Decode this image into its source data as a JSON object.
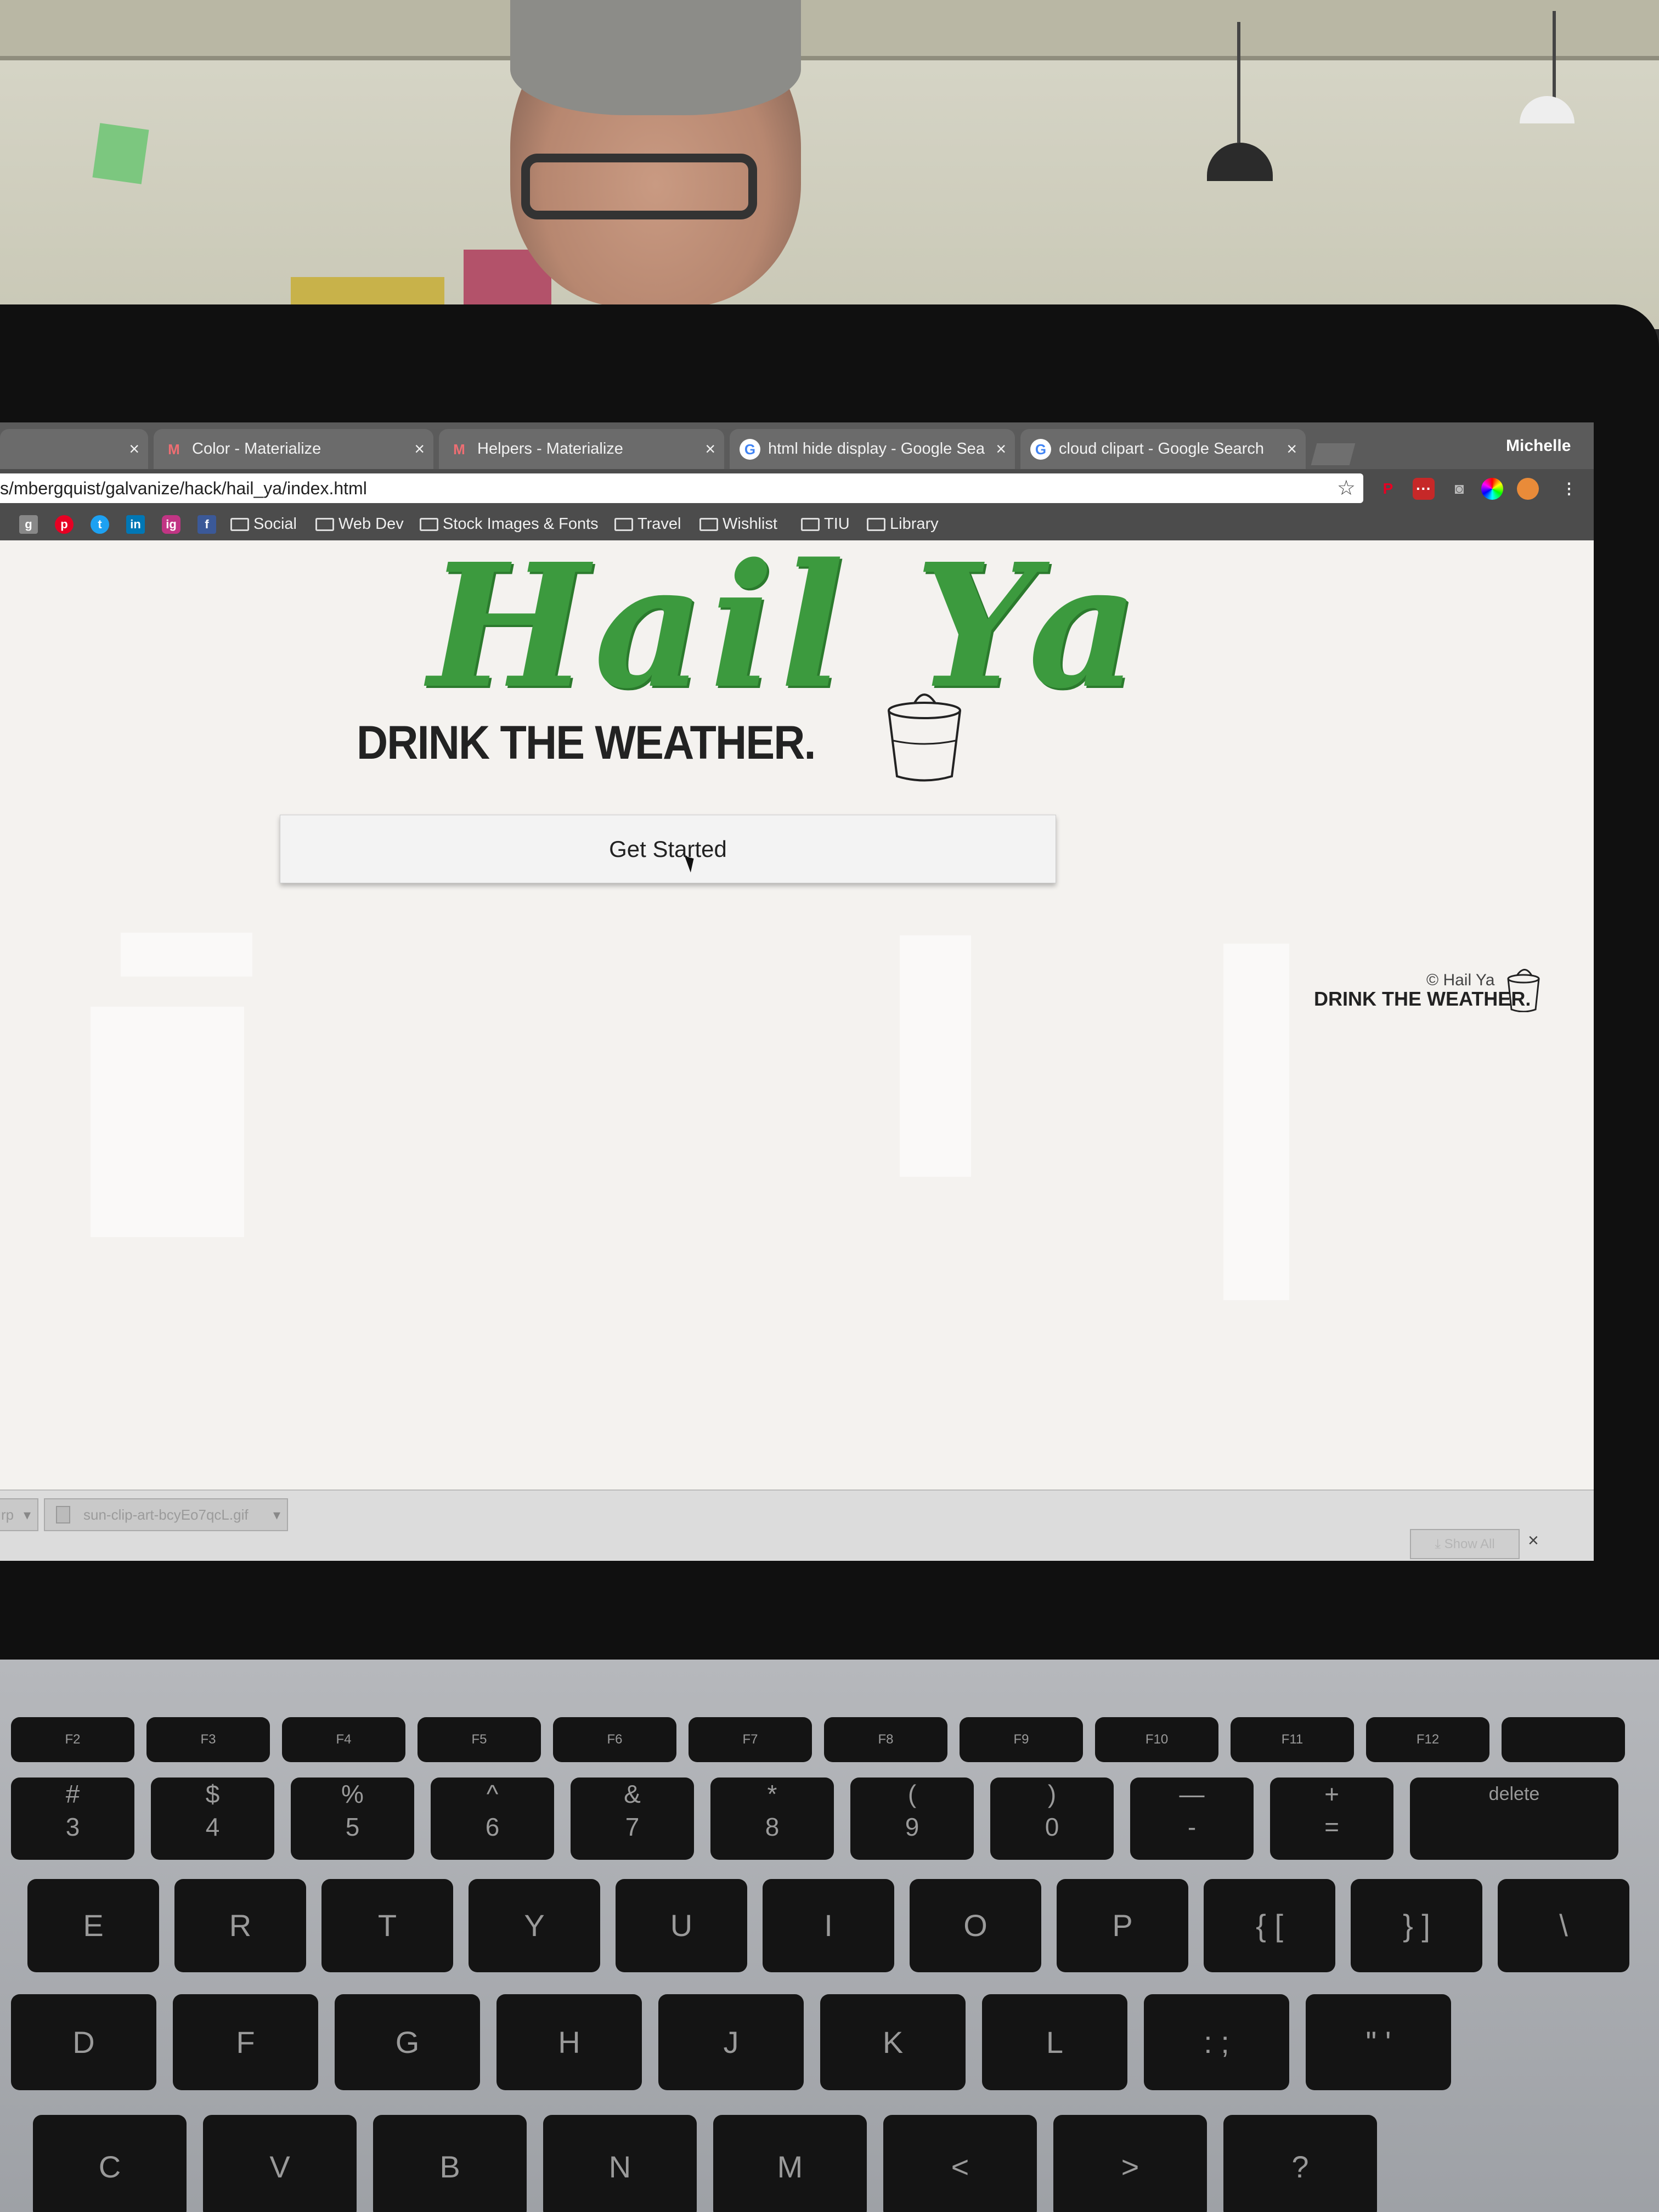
{
  "browser": {
    "tabs": [
      {
        "label": "",
        "favicon": "blank"
      },
      {
        "label": "Color - Materialize",
        "favicon": "materialize-icon"
      },
      {
        "label": "Helpers - Materialize",
        "favicon": "materialize-icon"
      },
      {
        "label": "html hide display - Google Sea",
        "favicon": "google-icon"
      },
      {
        "label": "cloud clipart - Google Search",
        "favicon": "google-icon"
      }
    ],
    "close_glyph": "×",
    "profile_name": "Michelle",
    "url": "s/mbergquist/galvanize/hack/hail_ya/index.html",
    "bookmarks": [
      "Social",
      "Web Dev",
      "Stock Images & Fonts",
      "Travel",
      "Wishlist",
      "TIU",
      "Library"
    ],
    "bookmark_icons": [
      "g",
      "p",
      "t",
      "in",
      "ig",
      "f"
    ]
  },
  "page": {
    "logo_text": "Hail Ya",
    "tagline": "DRINK THE WEATHER.",
    "cta_label": "Get Started",
    "footer_copyright": "© Hail Ya",
    "footer_tagline": "DRINK THE WEATHER.",
    "brand_green": "#3c9a3e"
  },
  "downloads": {
    "items": [
      "rp",
      "sun-clip-art-bcyEo7qcL.gif"
    ],
    "show_all_label": "Show All",
    "close_glyph": "×"
  },
  "keyboard": {
    "fn_row": [
      "F2",
      "F3",
      "F4",
      "F5",
      "F6",
      "F7",
      "F8",
      "F9",
      "F10",
      "F11",
      "F12",
      ""
    ],
    "num_row": [
      {
        "top": "#",
        "bottom": "3"
      },
      {
        "top": "$",
        "bottom": "4"
      },
      {
        "top": "%",
        "bottom": "5"
      },
      {
        "top": "^",
        "bottom": "6"
      },
      {
        "top": "&",
        "bottom": "7"
      },
      {
        "top": "*",
        "bottom": "8"
      },
      {
        "top": "(",
        "bottom": "9"
      },
      {
        "top": ")",
        "bottom": "0"
      },
      {
        "top": "—",
        "bottom": "-"
      },
      {
        "top": "+",
        "bottom": "="
      },
      {
        "top": "",
        "bottom": "delete"
      }
    ],
    "top_row": [
      "E",
      "R",
      "T",
      "Y",
      "U",
      "I",
      "O",
      "P",
      "{ [",
      "} ]",
      "\\"
    ],
    "home_row": [
      "D",
      "F",
      "G",
      "H",
      "J",
      "K",
      "L",
      ": ;",
      "\" '"
    ],
    "bottom_row": [
      "C",
      "V",
      "B",
      "N",
      "M",
      "<",
      ">",
      "?"
    ]
  }
}
